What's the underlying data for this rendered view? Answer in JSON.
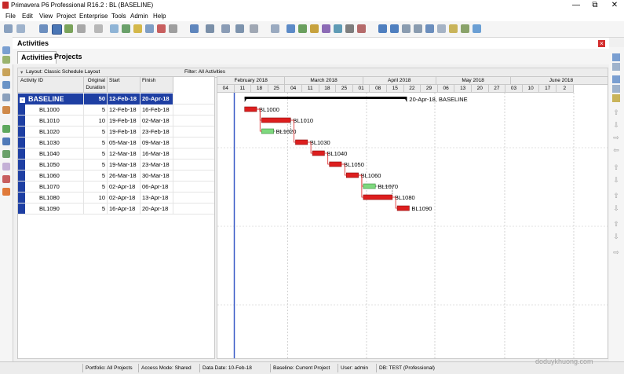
{
  "window": {
    "title": "Primavera P6 Professional R16.2 : BL (BASELINE)",
    "controls": {
      "minimize": "—",
      "restore": "⧉",
      "close": "✕"
    }
  },
  "menu": [
    "File",
    "Edit",
    "View",
    "Project",
    "Enterprise",
    "Tools",
    "Admin",
    "Help"
  ],
  "panel": {
    "title": "Activities",
    "close": "×"
  },
  "tabs": [
    "Activities",
    "Projects"
  ],
  "layout_bar": {
    "layout": "Layout: Classic Schedule Layout",
    "filter": "Filter: All Activities"
  },
  "columns": {
    "id": "Activity ID",
    "dur1": "Original",
    "dur2": "Duration",
    "start": "Start",
    "finish": "Finish"
  },
  "wbs": {
    "id": "BASELINE",
    "duration": "50",
    "start": "12-Feb-18",
    "finish": "20-Apr-18",
    "summary_label": "20-Apr-18, BASELINE",
    "expander": "-"
  },
  "activities": [
    {
      "id": "BL1000",
      "duration": "5",
      "start": "12-Feb-18",
      "finish": "16-Feb-18"
    },
    {
      "id": "BL1010",
      "duration": "10",
      "start": "19-Feb-18",
      "finish": "02-Mar-18"
    },
    {
      "id": "BL1020",
      "duration": "5",
      "start": "19-Feb-18",
      "finish": "23-Feb-18"
    },
    {
      "id": "BL1030",
      "duration": "5",
      "start": "05-Mar-18",
      "finish": "09-Mar-18"
    },
    {
      "id": "BL1040",
      "duration": "5",
      "start": "12-Mar-18",
      "finish": "16-Mar-18"
    },
    {
      "id": "BL1050",
      "duration": "5",
      "start": "19-Mar-18",
      "finish": "23-Mar-18"
    },
    {
      "id": "BL1060",
      "duration": "5",
      "start": "26-Mar-18",
      "finish": "30-Mar-18"
    },
    {
      "id": "BL1070",
      "duration": "5",
      "start": "02-Apr-18",
      "finish": "06-Apr-18"
    },
    {
      "id": "BL1080",
      "duration": "10",
      "start": "02-Apr-18",
      "finish": "13-Apr-18"
    },
    {
      "id": "BL1090",
      "duration": "5",
      "start": "16-Apr-18",
      "finish": "20-Apr-18"
    }
  ],
  "gantt": {
    "months": [
      "February 2018",
      "March 2018",
      "April 2018",
      "May 2018",
      "June 2018"
    ],
    "weeks": [
      "04",
      "11",
      "18",
      "25",
      "04",
      "11",
      "18",
      "25",
      "01",
      "08",
      "15",
      "22",
      "29",
      "06",
      "13",
      "20",
      "27",
      "03",
      "10",
      "17",
      "2"
    ],
    "colors": {
      "critical": "#dd1e1e",
      "noncritical": "#7ed87e",
      "summary": "#000000",
      "datadate": "#3a5bc7"
    }
  },
  "status": {
    "portfolio": "Portfolio: All Projects",
    "access": "Access Mode: Shared",
    "datadate": "Data Date: 10-Feb-18",
    "baseline": "Baseline: Current Project",
    "user": "User: admin",
    "db": "DB: TEST (Professional)"
  },
  "watermark": "doduykhuong.com"
}
